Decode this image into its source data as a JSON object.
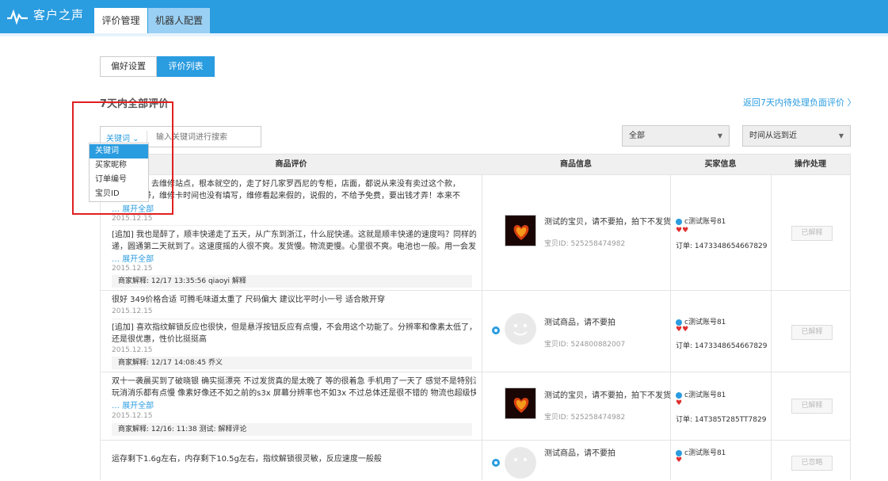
{
  "app": {
    "title": "客户之声"
  },
  "top_tabs": [
    {
      "label": "评价管理",
      "active": true
    },
    {
      "label": "机器人配置",
      "active": false
    }
  ],
  "sub_tabs": [
    {
      "label": "偏好设置",
      "active": false
    },
    {
      "label": "评价列表",
      "active": true
    }
  ],
  "section_title": "7天内全部评价",
  "return_link": "返回7天内待处理负面评价 〉",
  "search": {
    "keyword_select": "关键词",
    "placeholder": "输入关键词进行搜索"
  },
  "dropdown": {
    "items": [
      "关键词",
      "买家昵称",
      "订单编号",
      "宝贝ID"
    ],
    "selected": "关键词"
  },
  "filters": {
    "status": "全部",
    "sort": "时间从远到近"
  },
  "table": {
    "headers": [
      "商品评价",
      "商品信息",
      "买家信息",
      "操作处理"
    ],
    "rows": [
      {
        "review_lines": [
          "弄个表带，去维修站点，根本就空的，走了好几家罗西尼的专柜，店面，都说从来没有卖过这个款，",
          "工具弄表带，维修卡时间也没有填写，维修看起来假的，说假的，不给予免费，要出钱才弄！本来不"
        ],
        "more": "展开全部",
        "date": "2015.12.15",
        "followup_lines": [
          "[追加] 我也是醉了，顺丰快递走了五天，从广东到浙江，什么屁快递。这就是顺丰快递的速度吗？同样的快",
          "递，圆通第二天就到了。这速度摇的人很不爽。发货慢。物流更慢。心里很不爽。电池也一般。用一会发热。。"
        ],
        "followup_more": "展开全部",
        "followup_date": "2015.12.15",
        "reply": "商家解释: 12/17 13:35:56 qiaoyi 解释",
        "product_name": "测试的宝贝，请不要拍，拍下不发货",
        "product_id": "宝贝ID: 525258474982",
        "buyer": "c测试账号81",
        "order": "订单: 1473348654667829",
        "action": "已解释"
      },
      {
        "review_lines": [
          "很好 349价格合适 可腾毛味道太重了 尺码偏大 建议比平时小一号 适合敞开穿"
        ],
        "date": "2015.12.15",
        "followup_lines": [
          "[追加] 喜欢指纹解锁反应也很快，但是悬浮按钮反应有点慢，不会用这个功能了。分辨率和像素太低了，不过",
          "还是很优惠，性价比挺挺高"
        ],
        "followup_date": "2015.12.15",
        "reply": "商家解释: 12/17 14:08:45 乔义",
        "product_name": "测试商品，请不要拍",
        "product_id": "宝贝ID: 524800882007",
        "buyer": "c测试账号81",
        "order": "订单: 1473348654667829",
        "action": "已解释"
      },
      {
        "review_lines": [
          "双十一袭晨买到了破晓银 确实挺漂亮 不过发货真的是太晚了 等的很着急 手机用了一天了 感觉不是特别流畅",
          "玩消消乐都有点慢 像素好像还不如之前的s3x 屏幕分辨率也不如3x 不过总体还是很不错的 物流也超级快 发货"
        ],
        "more": "展开全部",
        "date": "2015.12.15",
        "reply": "商家解释: 12/16: 11:38 测试: 解释评论",
        "product_name": "测试的宝贝，请不要拍，拍下不发货",
        "product_id": "宝贝ID: 525258474982",
        "buyer": "c测试账号81",
        "order": "订单: 14T385T285TT7829",
        "action": "已解释"
      },
      {
        "review_lines": [
          "运存剩下1.6g左右，内存剩下10.5g左右，指纹解锁很灵敏，反应速度一般般"
        ],
        "product_name": "测试商品，请不要拍",
        "buyer": "c测试账号81",
        "action": "已忽略"
      }
    ]
  },
  "colors": {
    "brand": "#2a9ce0",
    "highlight": "#e02020"
  }
}
